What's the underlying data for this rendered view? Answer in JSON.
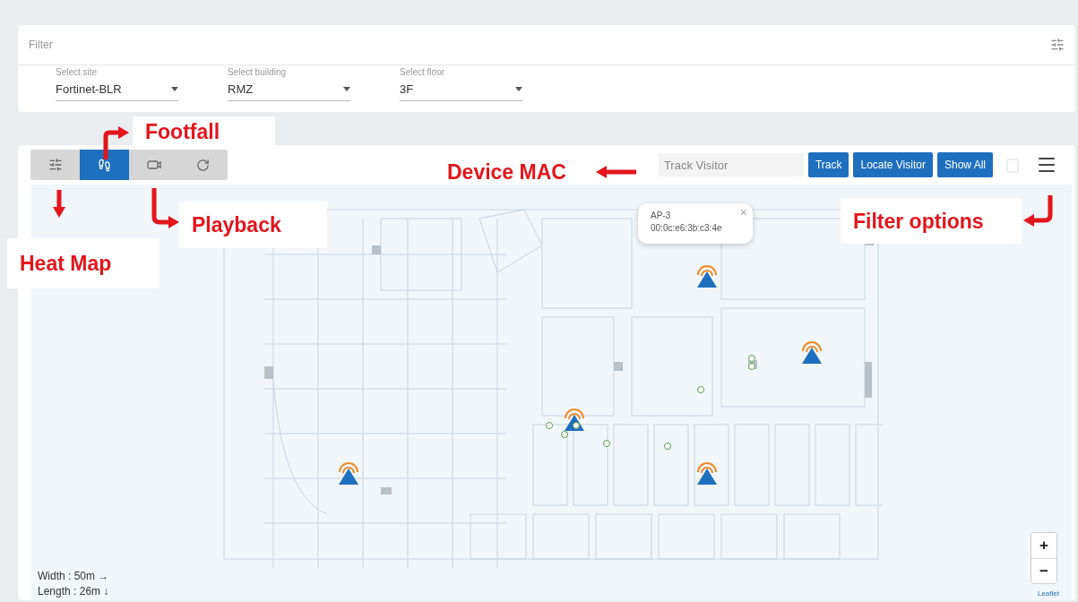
{
  "filter": {
    "placeholder": "Filter"
  },
  "selects": [
    {
      "label": "Select site",
      "value": "Fortinet-BLR"
    },
    {
      "label": "Select building",
      "value": "RMZ"
    },
    {
      "label": "Select floor",
      "value": "3F"
    }
  ],
  "modes": [
    {
      "kind": "heatmap",
      "selected": false
    },
    {
      "kind": "footfall",
      "selected": true
    },
    {
      "kind": "playback",
      "selected": false
    },
    {
      "kind": "refresh",
      "selected": false
    }
  ],
  "track": {
    "placeholder": "Track Visitor",
    "buttons": [
      "Track",
      "Locate Visitor",
      "Show All"
    ]
  },
  "popup": {
    "title": "AP-3",
    "mac": "00:0c:e6:3b:c3:4e",
    "close": "×"
  },
  "scale": [
    "Width : 50m →",
    "Length : 26m ↓"
  ],
  "zoom": [
    "+",
    "−"
  ],
  "attribution": "Leaflet",
  "annotations": [
    {
      "kind": "footfall",
      "text": "Footfall"
    },
    {
      "kind": "mac",
      "text": "Device MAC"
    },
    {
      "kind": "playback",
      "text": "Playback"
    },
    {
      "kind": "heatmap",
      "text": "Heat Map"
    },
    {
      "kind": "filter",
      "text": "Filter options"
    }
  ]
}
